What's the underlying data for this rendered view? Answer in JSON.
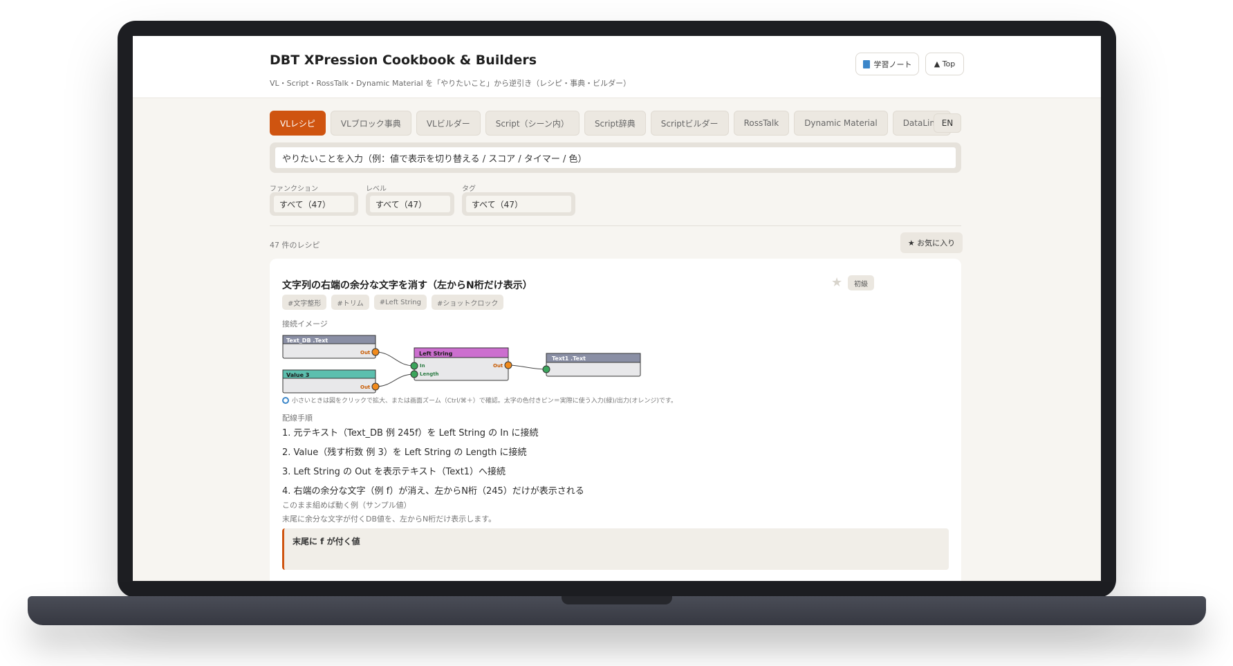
{
  "header": {
    "title": "DBT XPression Cookbook & Builders",
    "subtitle": "VL・Script・RossTalk・Dynamic Material を「やりたいこと」から逆引き（レシピ・事典・ビルダー）",
    "note_button": "学習ノート",
    "top_button": "▲ Top"
  },
  "tabs": [
    {
      "label": "VLレシピ",
      "active": true
    },
    {
      "label": "VLブロック事典"
    },
    {
      "label": "VLビルダー"
    },
    {
      "label": "Script（シーン内）"
    },
    {
      "label": "Script辞典"
    },
    {
      "label": "Scriptビルダー"
    },
    {
      "label": "RossTalk"
    },
    {
      "label": "Dynamic Material"
    },
    {
      "label": "DataLinq"
    }
  ],
  "lang_button": "EN",
  "search": {
    "placeholder": "やりたいことを入力（例：値で表示を切り替える / スコア / タイマー / 色）",
    "value": "やりたいことを入力（例：値で表示を切り替える / スコア / タイマー / 色）"
  },
  "filters": [
    {
      "label": "ファンクション",
      "selected": "すべて（47）"
    },
    {
      "label": "レベル",
      "selected": "すべて（47）"
    },
    {
      "label": "タグ",
      "selected": "すべて（47）"
    }
  ],
  "results": {
    "count_text": "47 件のレシピ",
    "favorites_button": "★ お気に入り"
  },
  "recipe": {
    "title": "文字列の右端の余分な文字を消す（左からN桁だけ表示）",
    "level": "初級",
    "tags": [
      "#文字整形",
      "#トリム",
      "#Left String",
      "#ショットクロック"
    ],
    "diagram_label": "接続イメージ",
    "diagram": {
      "nodes": {
        "text_db": {
          "title": "Text_DB .Text",
          "port_out": "Out",
          "color": "#8a8fa5"
        },
        "value3": {
          "title": "Value 3",
          "port_out": "Out",
          "color": "#5cbfae"
        },
        "left_string": {
          "title": "Left String",
          "port_in": "In",
          "port_length": "Length",
          "port_out": "Out",
          "color": "#cc6fcf"
        },
        "text1": {
          "title": "Text1 .Text",
          "color": "#8a8fa5"
        }
      },
      "colors": {
        "out_port": "#f08a1c",
        "in_port": "#3ba55c",
        "wire": "#444444"
      }
    },
    "hint": "小さいときは図をクリックで拡大、または画面ズーム（Ctrl/⌘＋）で確認。太字の色付きピン＝実際に使う入力(緑)/出力(オレンジ)です。",
    "steps_label": "配線手順",
    "steps": [
      "1. 元テキスト（Text_DB 例 245f）を Left String の In に接続",
      "2. Value（残す桁数 例 3）を Left String の Length に接続",
      "3. Left String の Out を表示テキスト（Text1）へ接続",
      "4. 右端の余分な文字（例 f）が消え、左からN桁（245）だけが表示される"
    ],
    "sample_label": "このまま組めば動く例（サンプル値）",
    "sample_desc": "末尾に余分な文字が付くDB値を、左からN桁だけ表示します。",
    "example_title": "末尾に f が付く値"
  },
  "accent_color": "#cf5410"
}
